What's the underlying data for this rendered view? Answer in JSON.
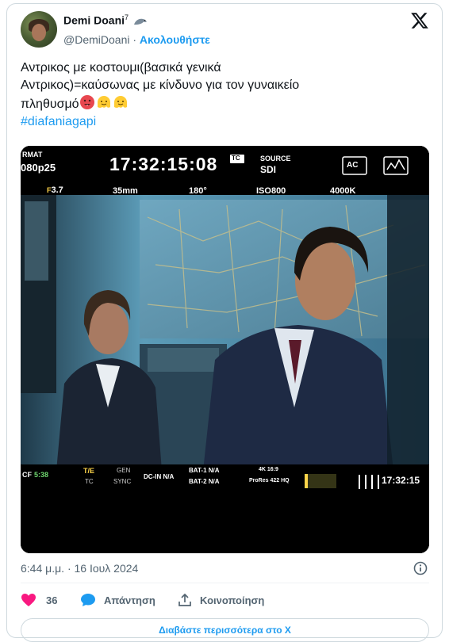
{
  "tweet": {
    "author": {
      "name": "Demi Doani",
      "superscript": "7",
      "handle": "@DemiDoani",
      "separator": "·",
      "follow_label": "Ακολουθήστε"
    },
    "text_line1": "Αντρικος με κοστουμι(βασικά γενικά",
    "text_line2": "Αντρικος)=καύσωνας με κίνδυνο για τον γυναικείο",
    "text_line3": "πληθυσμό",
    "hashtag": "#diafaniagapi",
    "timestamp": "6:44 μ.μ. · 16 Ιουλ 2024",
    "likes": "36",
    "reply_label": "Απάντηση",
    "share_label": "Κοινοποίηση",
    "read_more_label": "Διαβάστε περισσότερα στο X"
  },
  "camera_hud": {
    "format_label": "RMAT",
    "format_value": "080p25",
    "timecode": "17:32:15:08",
    "tc_label": "TC",
    "source_label": "SOURCE",
    "source_value": "SDI",
    "ac_label": "AC",
    "aperture": "3.7",
    "focal": "35mm",
    "shutter": "180°",
    "iso": "ISO800",
    "wb": "4000K",
    "cf_label": "CF",
    "cf_value": "5:38",
    "te_label": "T/E",
    "tc_small": "TC",
    "gen_label": "GEN",
    "sync_label": "SYNC",
    "dcin_label": "DC-IN N/A",
    "bat1": "BAT-1 N/A",
    "bat2": "BAT-2 N/A",
    "res": "4K 16:9",
    "codec": "ProRes 422 HQ",
    "timecode_small": "17:32:15"
  },
  "colors": {
    "accent": "#1d9bf0",
    "like": "#f91880",
    "text": "#0f1419",
    "muted": "#536471"
  }
}
